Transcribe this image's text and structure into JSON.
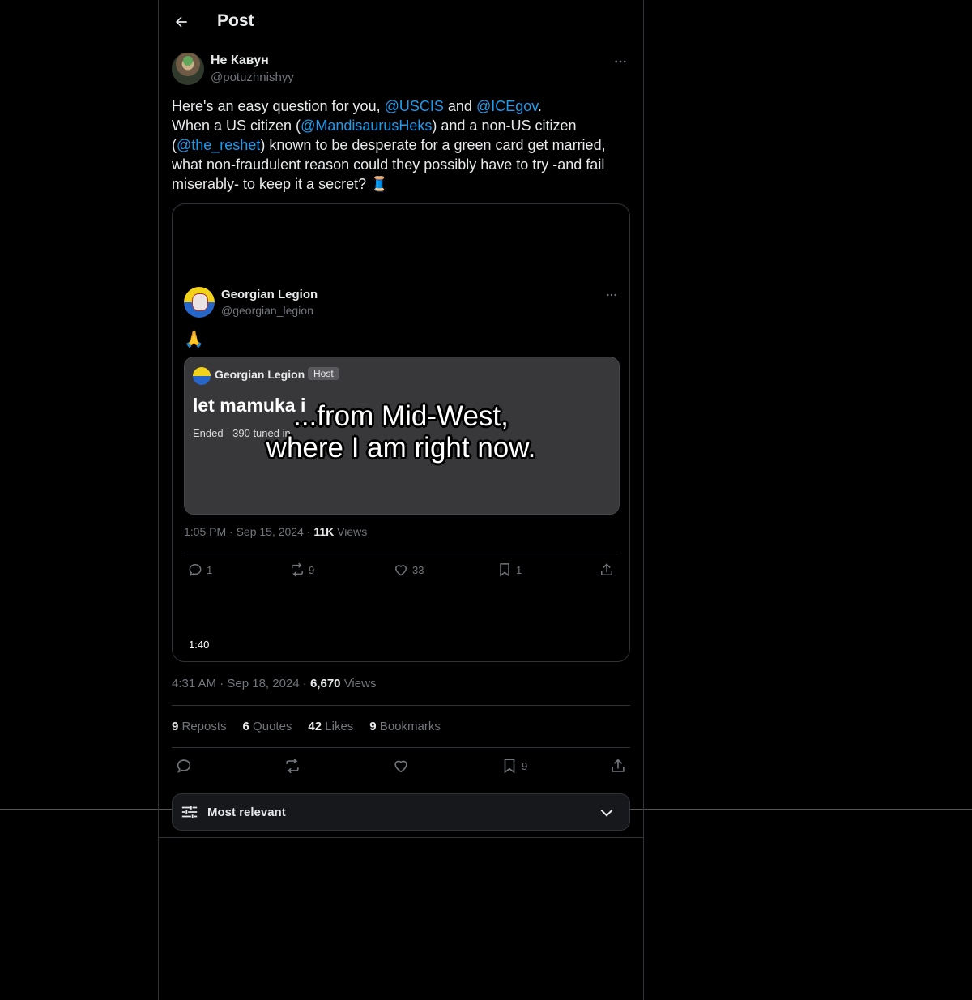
{
  "header": {
    "title": "Post"
  },
  "author": {
    "name": "Не Кавун",
    "handle": "@potuzhnishyy"
  },
  "post": {
    "text_parts": {
      "p1": "Here's an easy question for you, ",
      "m1": "@USCIS",
      "p2": " and ",
      "m2": "@ICEgov",
      "p3": ".",
      "p4": "When a US citizen (",
      "m3": "@MandisaurusHeks",
      "p5": ") and a non-US citizen (",
      "m4": "@the_reshet",
      "p6": ") known to be desperate for a green card get married, what non-fraudulent reason could they possibly have to try -and fail miserably- to keep it a secret? ",
      "emoji": "🧵"
    }
  },
  "embedded_video": {
    "author_name": "Georgian Legion",
    "author_handle": "@georgian_legion",
    "emoji": "🙏",
    "space": {
      "host_name": "Georgian Legion",
      "host_badge": "Host",
      "title": "let mamuka i",
      "meta": "Ended · 390 tuned in"
    },
    "caption_line1": "...from Mid-West,",
    "caption_line2": "where I am right now.",
    "timestamp": "1:05 PM · Sep 15, 2024 · ",
    "views_count": "11K",
    "views_label": " Views",
    "replies": "1",
    "reposts": "9",
    "likes": "33",
    "bookmarks": "1",
    "duration": "1:40"
  },
  "meta": {
    "time": "4:31 AM",
    "sep1": " · ",
    "date": "Sep 18, 2024",
    "sep2": " · ",
    "views": "6,670",
    "views_label": " Views"
  },
  "stats": {
    "reposts_count": "9",
    "reposts_label": " Reposts",
    "quotes_count": "6",
    "quotes_label": " Quotes",
    "likes_count": "42",
    "likes_label": " Likes",
    "bookmarks_count": "9",
    "bookmarks_label": " Bookmarks"
  },
  "actions": {
    "bookmark_count": "9"
  },
  "sort": {
    "label": "Most relevant"
  },
  "icons": {
    "back": "arrow-left-icon",
    "more": "more-horizontal-icon",
    "reply": "reply-icon",
    "repost": "repost-icon",
    "like": "heart-icon",
    "bookmark": "bookmark-icon",
    "share": "share-icon",
    "sort": "sliders-icon",
    "chevron": "chevron-down-icon"
  },
  "colors": {
    "accent": "#1d9bf0",
    "text": "#e7e9ea",
    "muted": "#71767b",
    "border": "#2f3336"
  }
}
